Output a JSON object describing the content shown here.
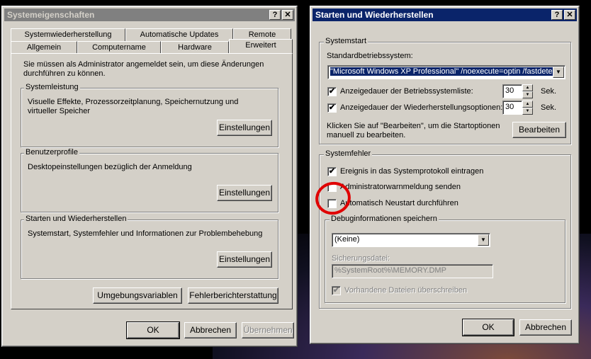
{
  "left_window": {
    "title": "Systemeigenschaften",
    "help_btn": "?",
    "close_btn": "✕",
    "tabs_top": [
      "Systemwiederherstellung",
      "Automatische Updates",
      "Remote"
    ],
    "tabs_bottom": [
      "Allgemein",
      "Computername",
      "Hardware",
      "Erweitert"
    ],
    "admin_note": "Sie müssen als Administrator angemeldet sein, um diese Änderungen durchführen zu können.",
    "group_performance": {
      "label": "Systemleistung",
      "text": "Visuelle Effekte, Prozessorzeitplanung, Speichernutzung und virtueller Speicher",
      "button": "Einstellungen"
    },
    "group_profiles": {
      "label": "Benutzerprofile",
      "text": "Desktopeinstellungen bezüglich der Anmeldung",
      "button": "Einstellungen"
    },
    "group_startup": {
      "label": "Starten und Wiederherstellen",
      "text": "Systemstart, Systemfehler und Informationen zur Problembehebung",
      "button": "Einstellungen"
    },
    "env_button": "Umgebungsvariablen",
    "error_report_button": "Fehlerberichterstattung",
    "ok": "OK",
    "cancel": "Abbrechen",
    "apply": "Übernehmen"
  },
  "right_window": {
    "title": "Starten und Wiederherstellen",
    "help_btn": "?",
    "close_btn": "✕",
    "systemstart": {
      "label": "Systemstart",
      "default_os_label": "Standardbetriebssystem:",
      "default_os_value": "\"Microsoft Windows XP Professional\" /noexecute=optin /fastdetect",
      "show_list_label": "Anzeigedauer der Betriebssystemliste:",
      "show_list_value": "30",
      "show_recovery_label": "Anzeigedauer der Wiederherstellungsoptionen:",
      "show_recovery_value": "30",
      "unit": "Sek.",
      "edit_note": "Klicken Sie auf \"Bearbeiten\", um die Startoptionen manuell zu bearbeiten.",
      "edit_button": "Bearbeiten"
    },
    "systemfehler": {
      "label": "Systemfehler",
      "log_event": "Ereignis in das Systemprotokoll eintragen",
      "admin_alert": "Administratorwarnmeldung senden",
      "auto_restart": "Automatisch Neustart durchführen",
      "debug_label": "Debuginformationen speichern",
      "debug_value": "(Keine)",
      "dump_file_label": "Sicherungsdatei:",
      "dump_file_value": "%SystemRoot%\\MEMORY.DMP",
      "overwrite": "Vorhandene Dateien überschreiben"
    },
    "ok": "OK",
    "cancel": "Abbrechen"
  },
  "glyphs": {
    "check": "✔",
    "dropdown": "▼",
    "up": "▲",
    "down": "▼"
  }
}
